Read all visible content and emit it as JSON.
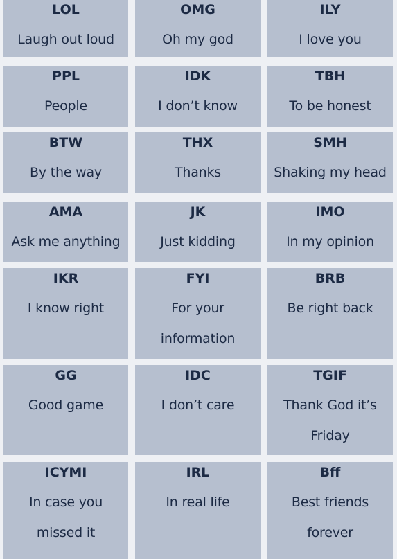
{
  "colors": {
    "background": "#eef0f4",
    "card": "#b6bfcf",
    "text": "#1c2a44"
  },
  "cards": [
    {
      "abbr": "LOL",
      "meaning": [
        "Laugh out loud"
      ]
    },
    {
      "abbr": "OMG",
      "meaning": [
        "Oh my god"
      ]
    },
    {
      "abbr": "ILY",
      "meaning": [
        "I love you"
      ]
    },
    {
      "abbr": "PPL",
      "meaning": [
        "People"
      ]
    },
    {
      "abbr": "IDK",
      "meaning": [
        "I don’t know"
      ]
    },
    {
      "abbr": "TBH",
      "meaning": [
        "To be honest"
      ]
    },
    {
      "abbr": "BTW",
      "meaning": [
        "By the way"
      ]
    },
    {
      "abbr": "THX",
      "meaning": [
        "Thanks"
      ]
    },
    {
      "abbr": "SMH",
      "meaning": [
        "Shaking my head"
      ]
    },
    {
      "abbr": "AMA",
      "meaning": [
        "Ask me anything"
      ]
    },
    {
      "abbr": "JK",
      "meaning": [
        "Just kidding"
      ]
    },
    {
      "abbr": "IMO",
      "meaning": [
        "In my opinion"
      ]
    },
    {
      "abbr": "IKR",
      "meaning": [
        "I know right"
      ]
    },
    {
      "abbr": "FYI",
      "meaning": [
        "For your",
        "information"
      ]
    },
    {
      "abbr": "BRB",
      "meaning": [
        "Be right back"
      ]
    },
    {
      "abbr": "GG",
      "meaning": [
        "Good game"
      ]
    },
    {
      "abbr": "IDC",
      "meaning": [
        "I don’t care"
      ]
    },
    {
      "abbr": "TGIF",
      "meaning": [
        "Thank God it’s",
        "Friday"
      ]
    },
    {
      "abbr": "ICYMI",
      "meaning": [
        "In case you",
        "missed it"
      ]
    },
    {
      "abbr": "IRL",
      "meaning": [
        "In real life"
      ]
    },
    {
      "abbr": "Bff",
      "meaning": [
        "Best friends",
        "forever"
      ]
    }
  ]
}
